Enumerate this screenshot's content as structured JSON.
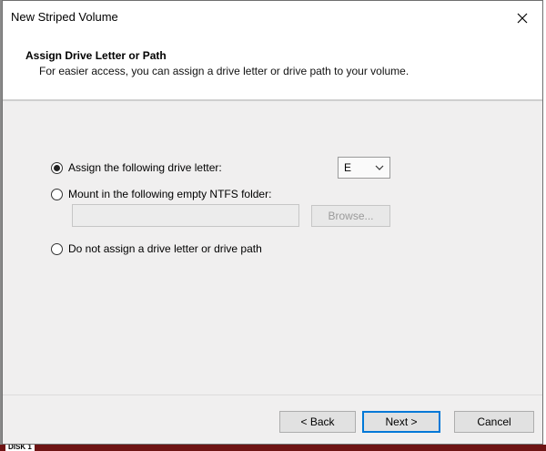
{
  "window": {
    "title": "New Striped Volume"
  },
  "header": {
    "title": "Assign Drive Letter or Path",
    "subtitle": "For easier access, you can assign a drive letter or drive path to your volume."
  },
  "options": {
    "assign_letter": {
      "label": "Assign the following drive letter:",
      "selected": true
    },
    "mount_folder": {
      "label": "Mount in the following empty NTFS folder:",
      "selected": false
    },
    "no_assign": {
      "label": "Do not assign a drive letter or drive path",
      "selected": false
    }
  },
  "drive_letter": {
    "value": "E"
  },
  "folder_path": {
    "value": ""
  },
  "browse_button": {
    "label": "Browse...",
    "enabled": false
  },
  "footer": {
    "back_label": "< Back",
    "next_label": "Next >",
    "cancel_label": "Cancel"
  },
  "background": {
    "bottom_left_text": "DISK 1"
  },
  "icons": {
    "close": "close-icon",
    "dropdown": "chevron-down-icon"
  },
  "colors": {
    "body_bg": "#f0efef",
    "default_button_border": "#0078d7"
  }
}
